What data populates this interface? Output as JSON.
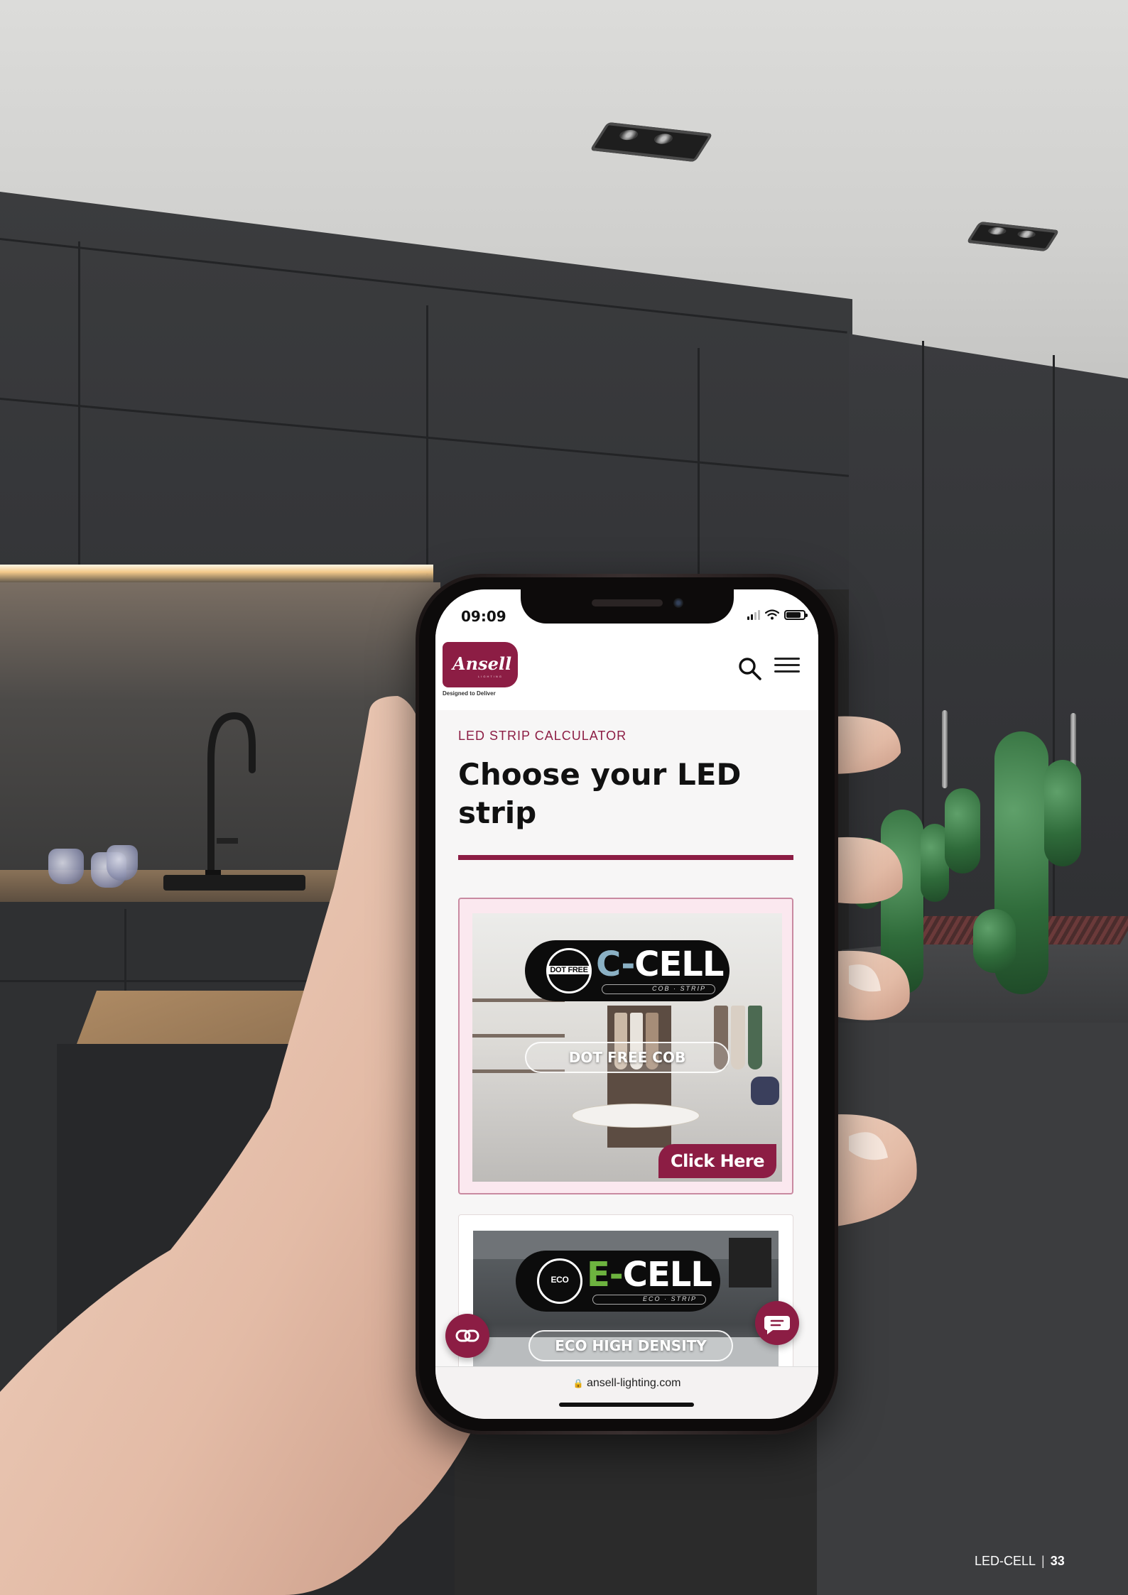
{
  "status_bar": {
    "time": "09:09"
  },
  "header": {
    "logo_text": "Ansell",
    "logo_sub": "LIGHTING",
    "tagline": "Designed to Deliver"
  },
  "main": {
    "section_label": "LED STRIP CALCULATOR",
    "heading": "Choose your LED strip"
  },
  "cards": [
    {
      "badge": "DOT FREE",
      "brand_prefix": "C-",
      "brand_suffix": "CELL",
      "brand_sub": "COB · STRIP",
      "feature": "DOT FREE COB",
      "cta": "Click Here"
    },
    {
      "badge": "ECO",
      "brand_prefix": "E-",
      "brand_suffix": "CELL",
      "brand_sub": "ECO · STRIP",
      "feature": "ECO HIGH DENSITY"
    }
  ],
  "browser": {
    "url": "ansell-lighting.com"
  },
  "footer": {
    "label": "LED-CELL",
    "page_number": "33"
  },
  "colors": {
    "brand": "#8c1d44",
    "cell_blue": "#8ab0c4",
    "cell_green": "#6db33f"
  }
}
